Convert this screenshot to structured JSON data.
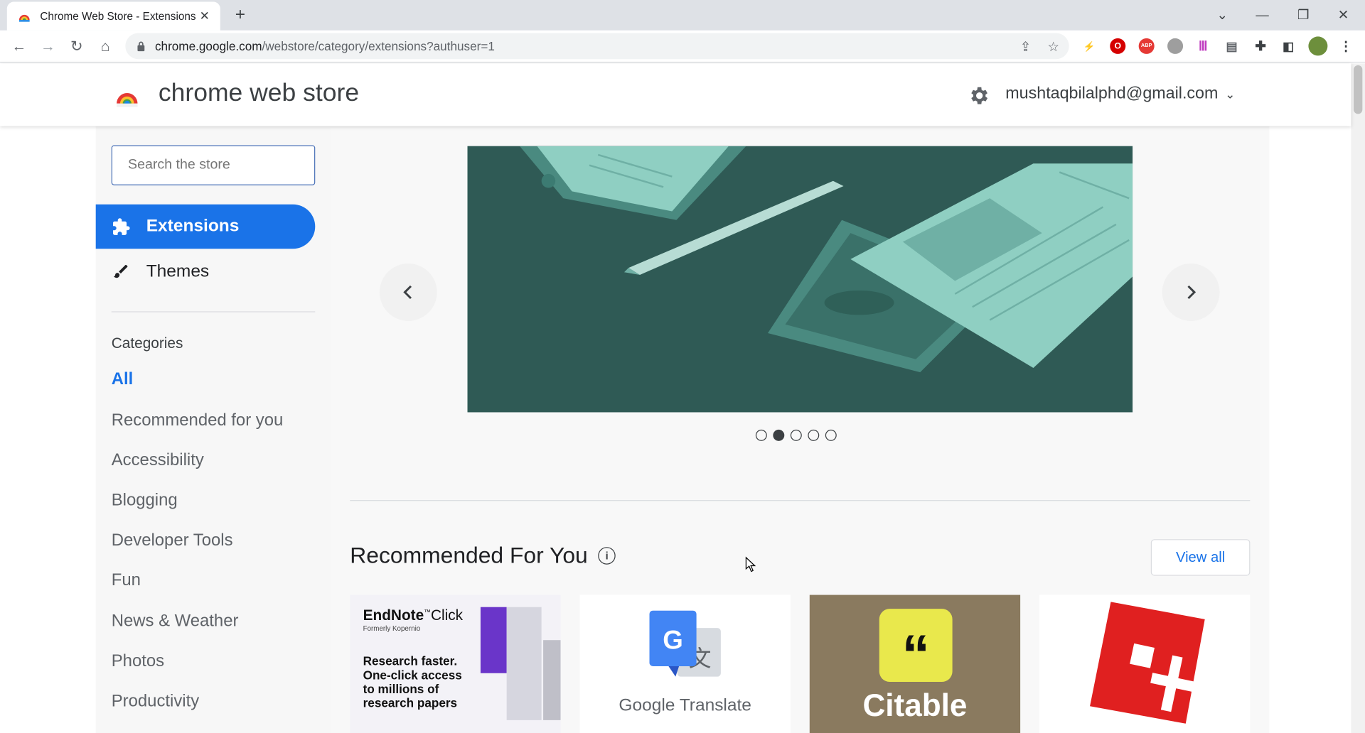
{
  "browser": {
    "tab_title": "Chrome Web Store - Extensions",
    "tab_close": "✕",
    "new_tab": "+",
    "url_host": "chrome.google.com",
    "url_path": "/webstore/category/extensions?authuser=1"
  },
  "store": {
    "title": "chrome web store",
    "account": "mushtaqbilalphd@gmail.com"
  },
  "sidebar": {
    "search_placeholder": "Search the store",
    "nav": [
      {
        "label": "Extensions",
        "icon": "puzzle-icon",
        "active": true
      },
      {
        "label": "Themes",
        "icon": "brush-icon",
        "active": false
      }
    ],
    "categories_heading": "Categories",
    "categories": [
      "All",
      "Recommended for you",
      "Accessibility",
      "Blogging",
      "Developer Tools",
      "Fun",
      "News & Weather",
      "Photos",
      "Productivity"
    ]
  },
  "main": {
    "carousel": {
      "dot_count": 5,
      "active_dot": 1
    },
    "section_title": "Recommended For You",
    "view_all": "View all",
    "tiles": [
      {
        "brand": "EndNote",
        "brand_sup": "™",
        "brand_suffix": "Click",
        "sub": "Formerly Kopernio",
        "tagline": [
          "Research faster.",
          "One-click access",
          "to millions of",
          "research papers"
        ]
      },
      {
        "label": "Google Translate"
      },
      {
        "label": "Citable"
      },
      {
        "label": ""
      }
    ]
  },
  "colors": {
    "accent": "#1a73e8",
    "tabstrip": "#dee1e6",
    "sidebar_bg": "#f7f7f7",
    "carousel_bg": "#2f5a55"
  }
}
